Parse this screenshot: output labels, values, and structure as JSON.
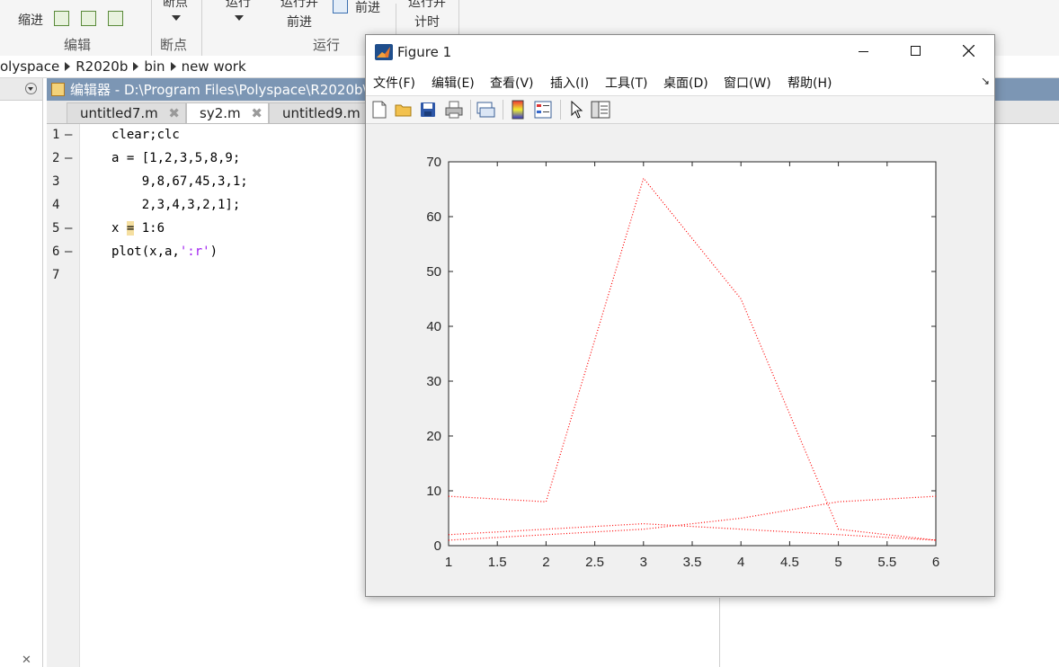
{
  "ribbon": {
    "indent_label": "缩进",
    "breakpoint_label": "断点",
    "run_label": "运行",
    "run_advance_label": "运行并\n前进",
    "advance_label": "前进",
    "run_time_label": "运行并\n计时",
    "groups": {
      "edit": "编辑",
      "breakpoints": "断点",
      "run": "运行"
    }
  },
  "breadcrumb": [
    "olyspace",
    "R2020b",
    "bin",
    "new work"
  ],
  "editor": {
    "title": "编辑器 - D:\\Program Files\\Polyspace\\R2020b\\",
    "tabs": [
      {
        "label": "untitled7.m",
        "active": false
      },
      {
        "label": "sy2.m",
        "active": true
      },
      {
        "label": "untitled9.m",
        "active": false
      }
    ],
    "line_numbers": [
      "1",
      "2",
      "3",
      "4",
      "5",
      "6",
      "7"
    ],
    "breakpoint_dashes": [
      "—",
      "—",
      "",
      "",
      "—",
      "—",
      ""
    ],
    "code": {
      "l1": "clear;clc",
      "l2": "a = [1,2,3,5,8,9;",
      "l3": "    9,8,67,45,3,1;",
      "l4": "    2,3,4,3,2,1];",
      "l5_pre": "x ",
      "l5_hl": "=",
      "l5_post": " 1:6",
      "l6_pre": "plot(x,a,",
      "l6_str": "':r'",
      "l6_post": ")"
    }
  },
  "figure": {
    "title": "Figure 1",
    "menu": [
      "文件(F)",
      "编辑(E)",
      "查看(V)",
      "插入(I)",
      "工具(T)",
      "桌面(D)",
      "窗口(W)",
      "帮助(H)"
    ],
    "toolbar_icons": [
      "new-figure-icon",
      "open-file-icon",
      "save-icon",
      "print-icon",
      "link-plot-icon",
      "colorbar-icon",
      "legend-icon",
      "pointer-icon",
      "property-editor-icon"
    ]
  },
  "chart_data": {
    "type": "line",
    "x": [
      1,
      2,
      3,
      4,
      5,
      6
    ],
    "xlim": [
      1,
      6
    ],
    "ylim": [
      0,
      70
    ],
    "x_ticks": [
      "1",
      "1.5",
      "2",
      "2.5",
      "3",
      "3.5",
      "4",
      "4.5",
      "5",
      "5.5",
      "6"
    ],
    "y_ticks": [
      "0",
      "10",
      "20",
      "30",
      "40",
      "50",
      "60",
      "70"
    ],
    "line_style": "dotted",
    "color": "#ff0000",
    "series": [
      {
        "values": [
          9,
          8,
          67,
          45,
          3,
          1
        ]
      },
      {
        "values": [
          1,
          2,
          3,
          5,
          8,
          9
        ]
      },
      {
        "values": [
          2,
          3,
          4,
          3,
          2,
          1
        ]
      }
    ],
    "grid": false,
    "legend": "none",
    "title": "",
    "xlabel": "",
    "ylabel": ""
  }
}
